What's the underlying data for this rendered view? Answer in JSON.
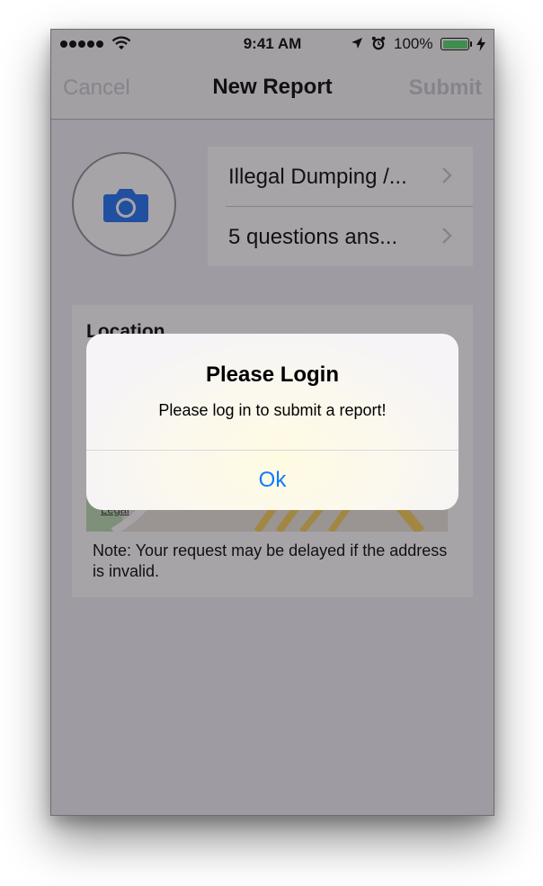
{
  "status_bar": {
    "time": "9:41 AM",
    "battery_percent": "100%",
    "battery_level": 1.0,
    "icons": [
      "signal-dots-icon",
      "wifi-icon",
      "location-arrow-icon",
      "alarm-icon",
      "battery-icon",
      "charging-bolt-icon"
    ]
  },
  "navbar": {
    "cancel_label": "Cancel",
    "title": "New Report",
    "submit_label": "Submit"
  },
  "photo": {
    "icon": "camera-icon"
  },
  "report_cells": [
    {
      "label": "Illegal Dumping /..."
    },
    {
      "label": "5 questions ans..."
    }
  ],
  "location": {
    "title": "Location",
    "map_legal": "Legal",
    "note": "Note: Your request may be delayed if the address is invalid."
  },
  "alert": {
    "title": "Please Login",
    "message": "Please log in to submit a report!",
    "ok_label": "Ok"
  },
  "colors": {
    "accent": "#0a7bff",
    "camera": "#1a6ff2",
    "battery": "#4cd964",
    "disabled_nav": "#c7c7cc"
  }
}
